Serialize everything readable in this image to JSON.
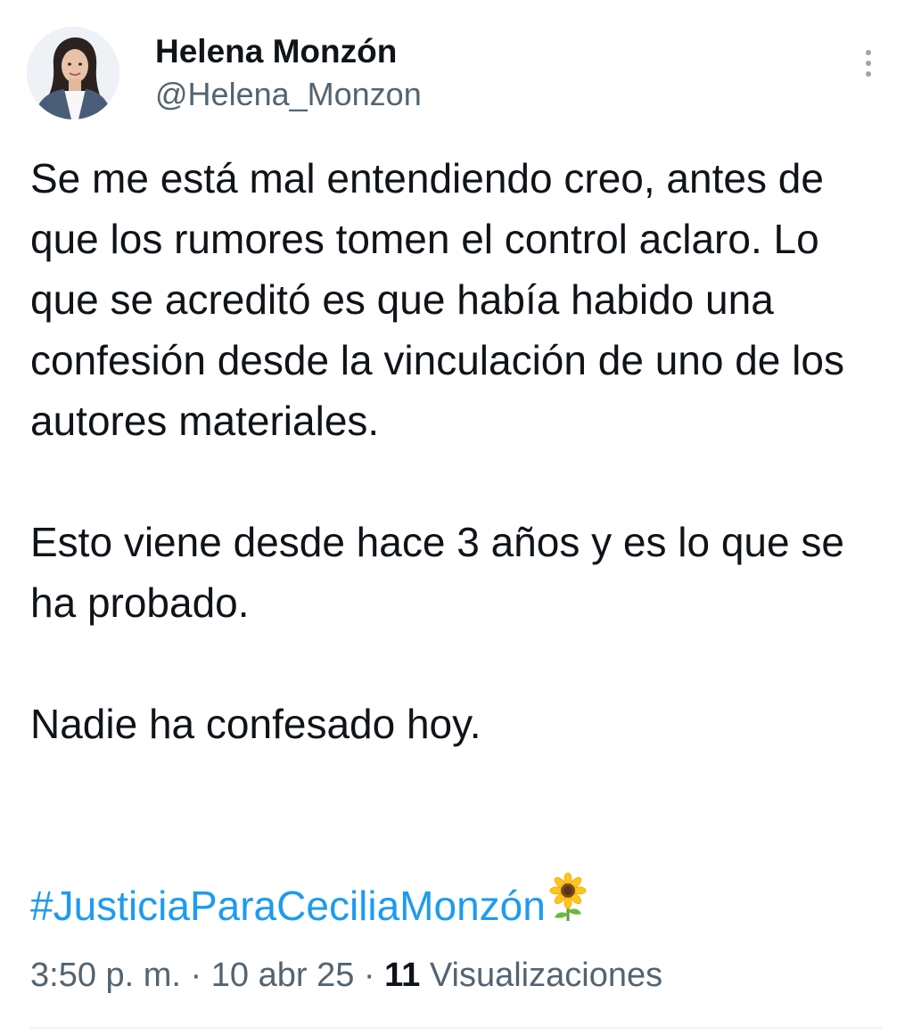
{
  "author": {
    "display_name": "Helena Monzón",
    "handle": "@Helena_Monzon"
  },
  "tweet": {
    "paragraphs": [
      "Se me está mal entendiendo creo, antes de que los rumores tomen el control aclaro. Lo que se acreditó es que había habido una confesión desde la vinculación de uno de los autores materiales.",
      "Esto viene desde hace 3 años y es lo que se ha probado.",
      "Nadie ha confesado hoy."
    ],
    "hashtag": "#JusticiaParaCeciliaMonzón",
    "emoji": "sunflower-icon"
  },
  "meta": {
    "time": "3:50 p. m.",
    "separator": " · ",
    "date": "10 abr 25",
    "views_count": "11",
    "views_label": "Visualizaciones"
  },
  "colors": {
    "text": "#0f1419",
    "secondary": "#536471",
    "link": "#1d9bf0",
    "divider": "#eff3f4"
  },
  "icons": {
    "more": "more-vertical-icon",
    "avatar": "avatar-photo"
  }
}
